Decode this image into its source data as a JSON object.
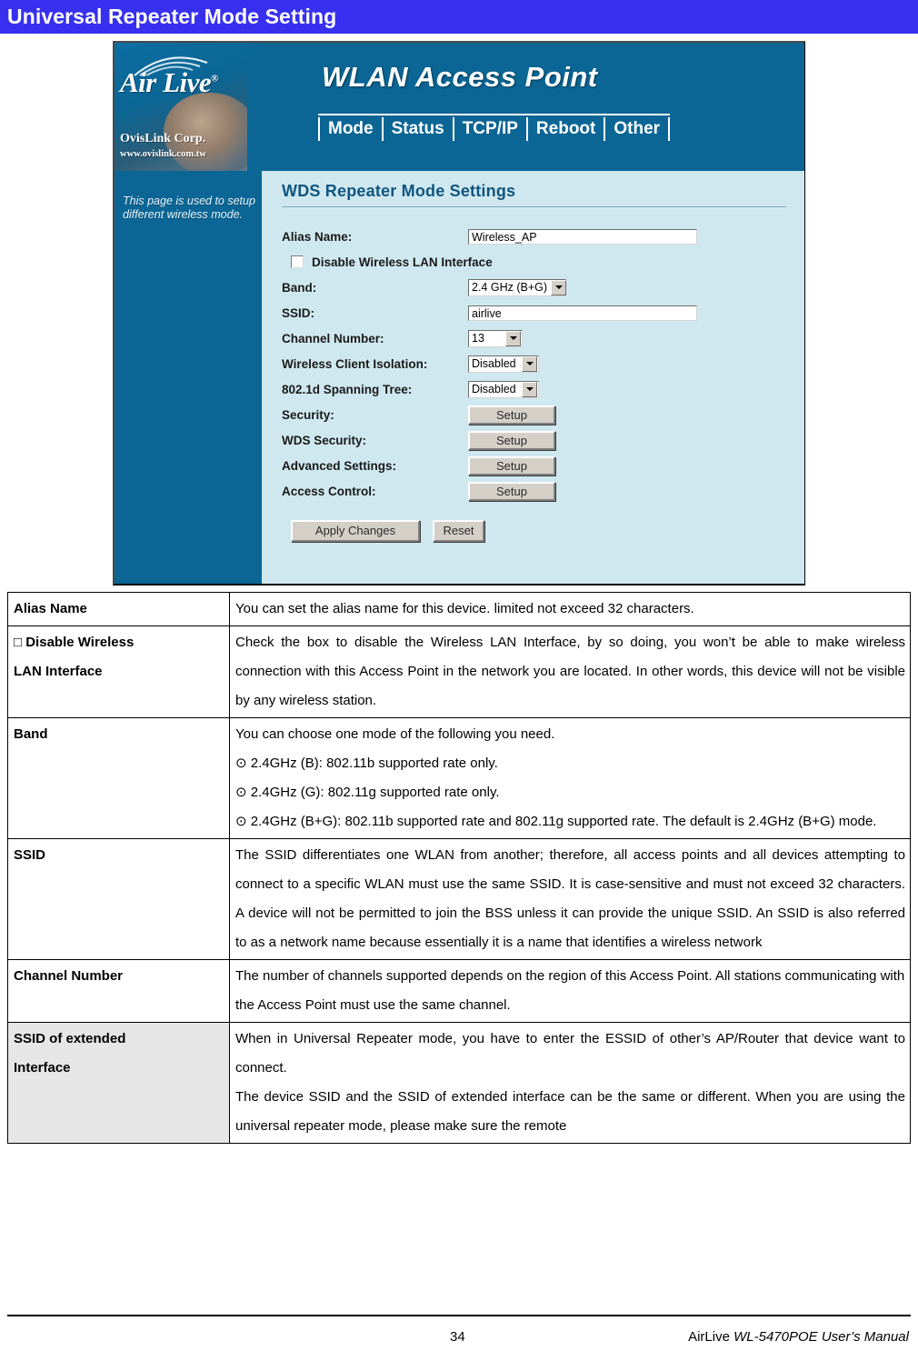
{
  "page": {
    "banner_title": "Universal Repeater Mode Setting",
    "banner_color": "#3730EE"
  },
  "screenshot": {
    "logo": {
      "brand": "Air Live",
      "registered": "®",
      "company": "OvisLink Corp.",
      "url": "www.ovislink.com.tw"
    },
    "product_title": "WLAN Access Point",
    "nav": [
      {
        "label": "Mode"
      },
      {
        "label": "Status"
      },
      {
        "label": "TCP/IP"
      },
      {
        "label": "Reboot"
      },
      {
        "label": "Other"
      }
    ],
    "sidebar_hint": "This page is used to setup different wireless mode.",
    "panel_title": "WDS Repeater Mode Settings",
    "fields": {
      "alias_label": "Alias Name:",
      "alias_value": "Wireless_AP",
      "disable_wlan_label": "Disable Wireless LAN Interface",
      "disable_wlan_checked": false,
      "band_label": "Band:",
      "band_value": "2.4 GHz (B+G)",
      "ssid_label": "SSID:",
      "ssid_value": "airlive",
      "channel_label": "Channel Number:",
      "channel_value": "13",
      "isolation_label": "Wireless Client Isolation:",
      "isolation_value": "Disabled",
      "spanning_label": "802.1d Spanning Tree:",
      "spanning_value": "Disabled",
      "security_label": "Security:",
      "security_button": "Setup",
      "wds_security_label": "WDS Security:",
      "wds_security_button": "Setup",
      "advanced_label": "Advanced Settings:",
      "advanced_button": "Setup",
      "access_control_label": "Access Control:",
      "access_control_button": "Setup"
    },
    "buttons": {
      "apply": "Apply Changes",
      "reset": "Reset"
    },
    "colors": {
      "header_blue": "#0b6695",
      "panel_blue": "#cfe8ef",
      "panel_title_blue": "#10557f"
    }
  },
  "table": {
    "rows": [
      {
        "key_lines": [
          "Alias Name"
        ],
        "shaded": false,
        "justify": false,
        "value_lines": [
          "You can set the alias name for this device. limited not exceed 32 characters."
        ]
      },
      {
        "key_lines": [
          "□   Disable   Wireless",
          "LAN Interface"
        ],
        "key_spread_first": true,
        "shaded": false,
        "justify": true,
        "value_lines": [
          "Check the box to disable the Wireless LAN Interface, by so doing, you won’t be able to make wireless connection with this Access Point in the network you are located. In other words, this device will not be visible by any wireless station."
        ]
      },
      {
        "key_lines": [
          "Band"
        ],
        "shaded": false,
        "justify": false,
        "value_lines": [
          "You can choose one mode of the following you need.",
          "⊙ 2.4GHz (B): 802.11b supported rate only.",
          "⊙ 2.4GHz (G): 802.11g supported rate only.",
          "⊙ 2.4GHz (B+G): 802.11b supported rate and 802.11g supported rate. The default is 2.4GHz (B+G) mode."
        ]
      },
      {
        "key_lines": [
          "SSID"
        ],
        "shaded": false,
        "justify": true,
        "value_lines": [
          "The SSID differentiates one WLAN from another; therefore, all access points and all devices attempting to connect to a specific WLAN must use the same SSID. It is case-sensitive and must not exceed 32 characters. A device will not be permitted to join the BSS unless it can provide the unique SSID. An SSID is also referred to as a network name because essentially it is a name that identifies a wireless network"
        ]
      },
      {
        "key_lines": [
          "Channel Number"
        ],
        "shaded": false,
        "justify": false,
        "value_lines": [
          "The number of channels supported depends on the region of this Access Point. All stations communicating with the Access Point must use the same channel."
        ]
      },
      {
        "key_lines": [
          "SSID of extended",
          "Interface"
        ],
        "shaded": true,
        "justify": true,
        "value_lines": [
          "When in Universal Repeater mode, you have to enter the ESSID of other’s AP/Router that device want to connect.",
          "The device SSID and the SSID of extended interface can be the same or different. When you are using the universal repeater mode, please make sure the remote"
        ]
      }
    ]
  },
  "footer": {
    "page_number": "34",
    "manual_prefix": "AirLive ",
    "manual_italic": "WL-5470POE User’s Manual"
  }
}
